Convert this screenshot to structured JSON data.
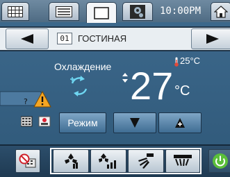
{
  "header": {
    "tabs": [
      {
        "icon": "grid-icon"
      },
      {
        "icon": "list-icon"
      },
      {
        "icon": "single-unit-icon"
      },
      {
        "icon": "settings-icon"
      }
    ],
    "clock": "10:00PM",
    "home_icon": "home-icon"
  },
  "room": {
    "number": "01",
    "name": "ГОСТИНАЯ"
  },
  "status": {
    "mode_label": "Охлаждение",
    "room_temperature": "25°C",
    "set_temperature": "27",
    "unit": "°C"
  },
  "controls": {
    "mode_button_label": "Режим"
  },
  "colors": {
    "background": "#3e6a8e",
    "warning": "#f5a623",
    "power": "#5bbf3a"
  }
}
